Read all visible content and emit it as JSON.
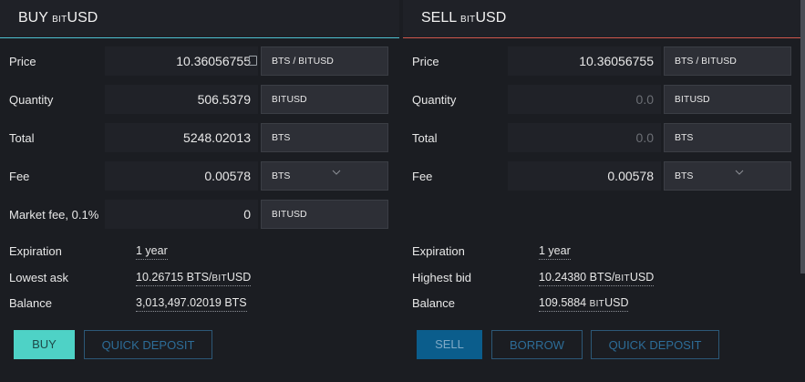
{
  "buy": {
    "title": "BUY",
    "asset_prefix": "BIT",
    "asset": "USD",
    "rows": {
      "price": {
        "label": "Price",
        "value": "10.36056755",
        "unit": "BTS / ",
        "unit_prefix": "BIT",
        "unit_asset": "USD"
      },
      "quantity": {
        "label": "Quantity",
        "value": "506.5379",
        "unit_prefix": "BIT",
        "unit_asset": "USD"
      },
      "total": {
        "label": "Total",
        "value": "5248.02013",
        "unit": "BTS"
      },
      "fee": {
        "label": "Fee",
        "value": "0.00578",
        "unit": "BTS"
      },
      "market_fee": {
        "label": "Market fee, 0.1%",
        "value": "0",
        "unit_prefix": "BIT",
        "unit_asset": "USD"
      }
    },
    "info": {
      "expiration": {
        "label": "Expiration",
        "value": "1 year"
      },
      "lowest_ask": {
        "label": "Lowest ask",
        "value": "10.26715 BTS/",
        "value_prefix": "BIT",
        "value_asset": "USD"
      },
      "balance": {
        "label": "Balance",
        "value": "3,013,497.02019 BTS"
      }
    },
    "buttons": {
      "buy": "BUY",
      "quick_deposit": "QUICK DEPOSIT"
    }
  },
  "sell": {
    "title": "SELL",
    "asset_prefix": "BIT",
    "asset": "USD",
    "rows": {
      "price": {
        "label": "Price",
        "value": "10.36056755",
        "unit": "BTS / ",
        "unit_prefix": "BIT",
        "unit_asset": "USD"
      },
      "quantity": {
        "label": "Quantity",
        "value": "0.0",
        "unit_prefix": "BIT",
        "unit_asset": "USD"
      },
      "total": {
        "label": "Total",
        "value": "0.0",
        "unit": "BTS"
      },
      "fee": {
        "label": "Fee",
        "value": "0.00578",
        "unit": "BTS"
      }
    },
    "info": {
      "expiration": {
        "label": "Expiration",
        "value": "1 year"
      },
      "highest_bid": {
        "label": "Highest bid",
        "value": "10.24380 BTS/",
        "value_prefix": "BIT",
        "value_asset": "USD"
      },
      "balance": {
        "label": "Balance",
        "value": "109.5884 ",
        "value_prefix": "BIT",
        "value_asset": "USD"
      }
    },
    "buttons": {
      "sell": "SELL",
      "borrow": "BORROW",
      "quick_deposit": "QUICK DEPOSIT"
    }
  },
  "colors": {
    "buy_accent": "#4dc0d1",
    "sell_accent": "#d0574c",
    "buy_button": "#4ed2c6",
    "sell_button": "#0b5d8c"
  }
}
